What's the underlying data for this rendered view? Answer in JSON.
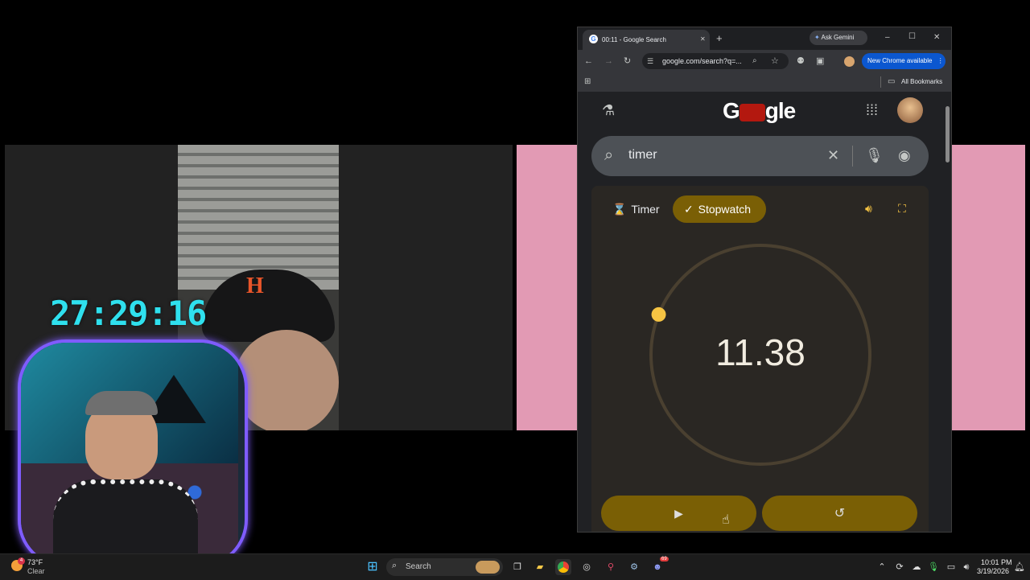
{
  "overlay": {
    "timer": "27:29:16"
  },
  "tab": {
    "title": "00:11 - Google Search",
    "close": "✕",
    "new_tab": "+"
  },
  "window": {
    "ask_gemini": "Ask Gemini",
    "minimize": "–",
    "maximize": "☐",
    "close": "✕"
  },
  "toolbar": {
    "url": "google.com/search?q=...",
    "update_button": "New Chrome available",
    "menu": "⋮"
  },
  "bookmarks": {
    "all_bookmarks": "All Bookmarks"
  },
  "google": {
    "logo_left": "G",
    "logo_right": "gle",
    "search_value": "timer",
    "tabs": {
      "timer": "Timer",
      "stopwatch": "Stopwatch"
    },
    "stopwatch_value": "11.38",
    "progress_fraction": 0.19,
    "accent": "#f6c443"
  },
  "taskbar": {
    "weather_temp": "73°F",
    "weather_text": "Clear",
    "weather_badge": "4",
    "search": "Search",
    "time": "10:01 PM",
    "date": "3/19/2026",
    "discord_badge": "69"
  }
}
